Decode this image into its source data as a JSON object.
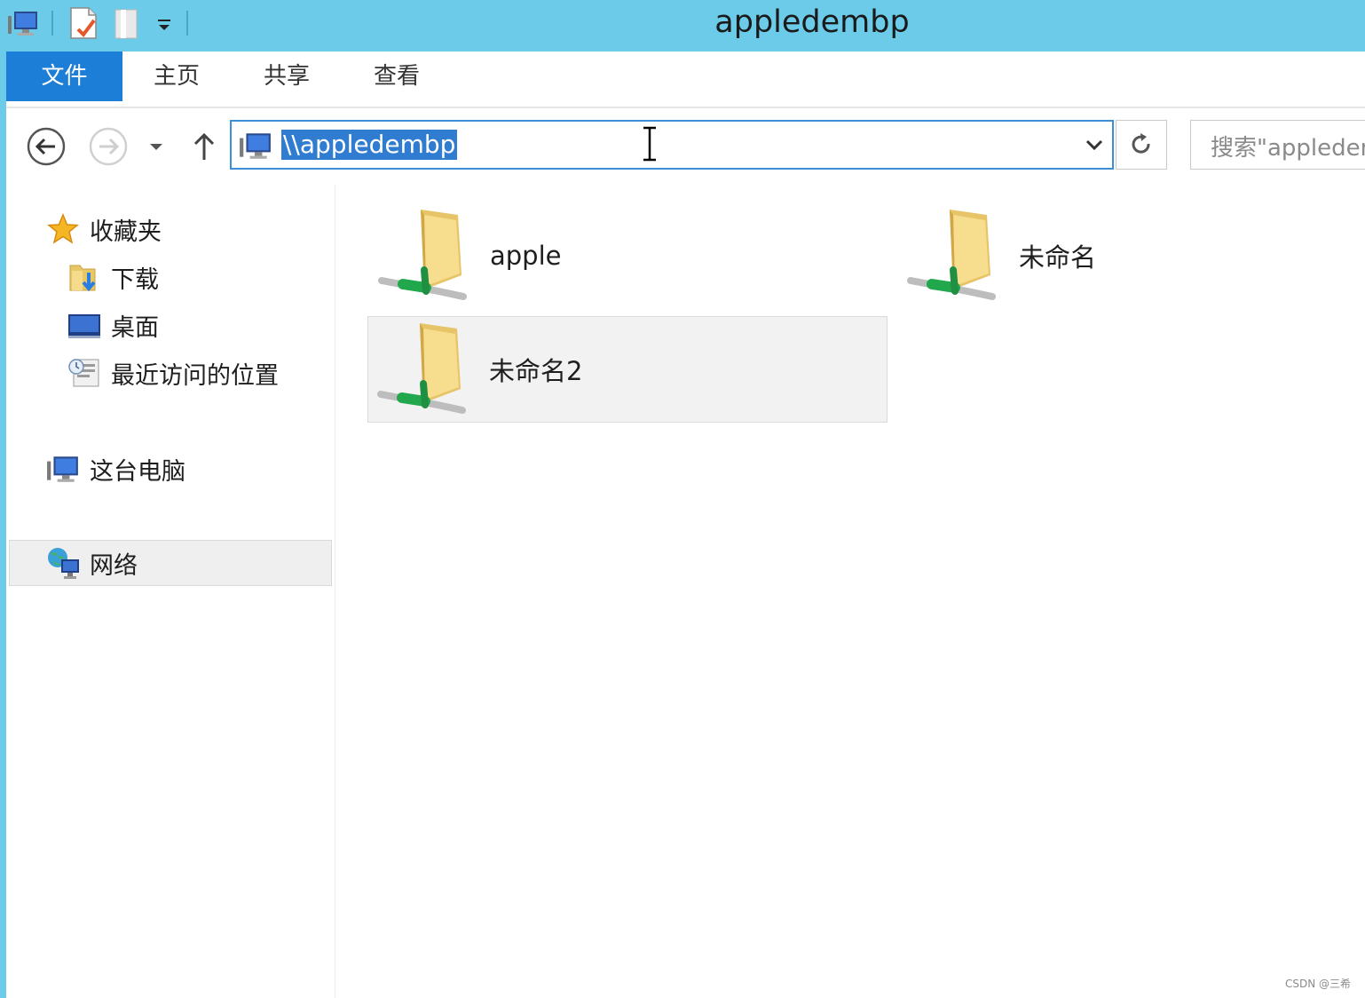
{
  "window": {
    "title": "appledembp"
  },
  "ribbon": {
    "tabs": [
      {
        "label": "文件",
        "active": true
      },
      {
        "label": "主页"
      },
      {
        "label": "共享"
      },
      {
        "label": "查看"
      }
    ]
  },
  "navigation": {
    "address": "\\\\appledembp",
    "search_placeholder": "搜索\"appledembp\""
  },
  "sidebar": {
    "favorites": {
      "label": "收藏夹",
      "icon": "star-icon"
    },
    "items": [
      {
        "label": "下载",
        "icon": "downloads-folder-icon"
      },
      {
        "label": "桌面",
        "icon": "desktop-icon"
      },
      {
        "label": "最近访问的位置",
        "icon": "recent-places-icon"
      }
    ],
    "this_pc": {
      "label": "这台电脑",
      "icon": "computer-icon"
    },
    "network": {
      "label": "网络",
      "icon": "network-icon",
      "selected": true
    }
  },
  "shares": [
    {
      "label": "apple",
      "icon": "network-share-folder-icon"
    },
    {
      "label": "未命名",
      "icon": "network-share-folder-icon"
    },
    {
      "label": "未命名2",
      "icon": "network-share-folder-icon",
      "selected": true
    }
  ],
  "watermark": "CSDN @三希",
  "colors": {
    "titlebar": "#6ccbe8",
    "file_tab": "#1c7ed6",
    "selection": "#2f7cd0"
  }
}
